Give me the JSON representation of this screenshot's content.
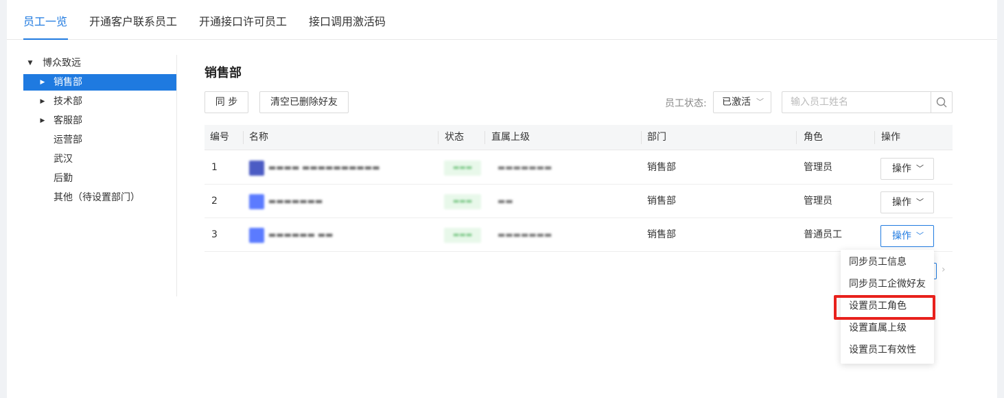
{
  "tabs": [
    {
      "label": "员工一览",
      "active": true
    },
    {
      "label": "开通客户联系员工",
      "active": false
    },
    {
      "label": "开通接口许可员工",
      "active": false
    },
    {
      "label": "接口调用激活码",
      "active": false
    }
  ],
  "tree": {
    "root": "博众致远",
    "items": [
      "销售部",
      "技术部",
      "客服部",
      "运营部",
      "武汉",
      "后勤",
      "其他（待设置部门）"
    ],
    "selected": "销售部"
  },
  "main": {
    "title": "销售部",
    "sync_button": "同 步",
    "clear_button": "清空已删除好友",
    "status_label": "员工状态:",
    "status_value": "已激活",
    "search_placeholder": "输入员工姓名"
  },
  "table": {
    "headers": [
      "编号",
      "名称",
      "状态",
      "直属上级",
      "部门",
      "角色",
      "操作"
    ],
    "rows": [
      {
        "no": "1",
        "dept": "销售部",
        "role": "管理员",
        "action": "操作"
      },
      {
        "no": "2",
        "dept": "销售部",
        "role": "管理员",
        "action": "操作"
      },
      {
        "no": "3",
        "dept": "销售部",
        "role": "普通员工",
        "action": "操作"
      }
    ]
  },
  "dropdown": {
    "items": [
      "同步员工信息",
      "同步员工企微好友",
      "设置员工角色",
      "设置直属上级",
      "设置员工有效性"
    ],
    "highlighted": "设置员工角色"
  },
  "colors": {
    "accent": "#1f7ae0",
    "highlight": "#e8211c"
  }
}
